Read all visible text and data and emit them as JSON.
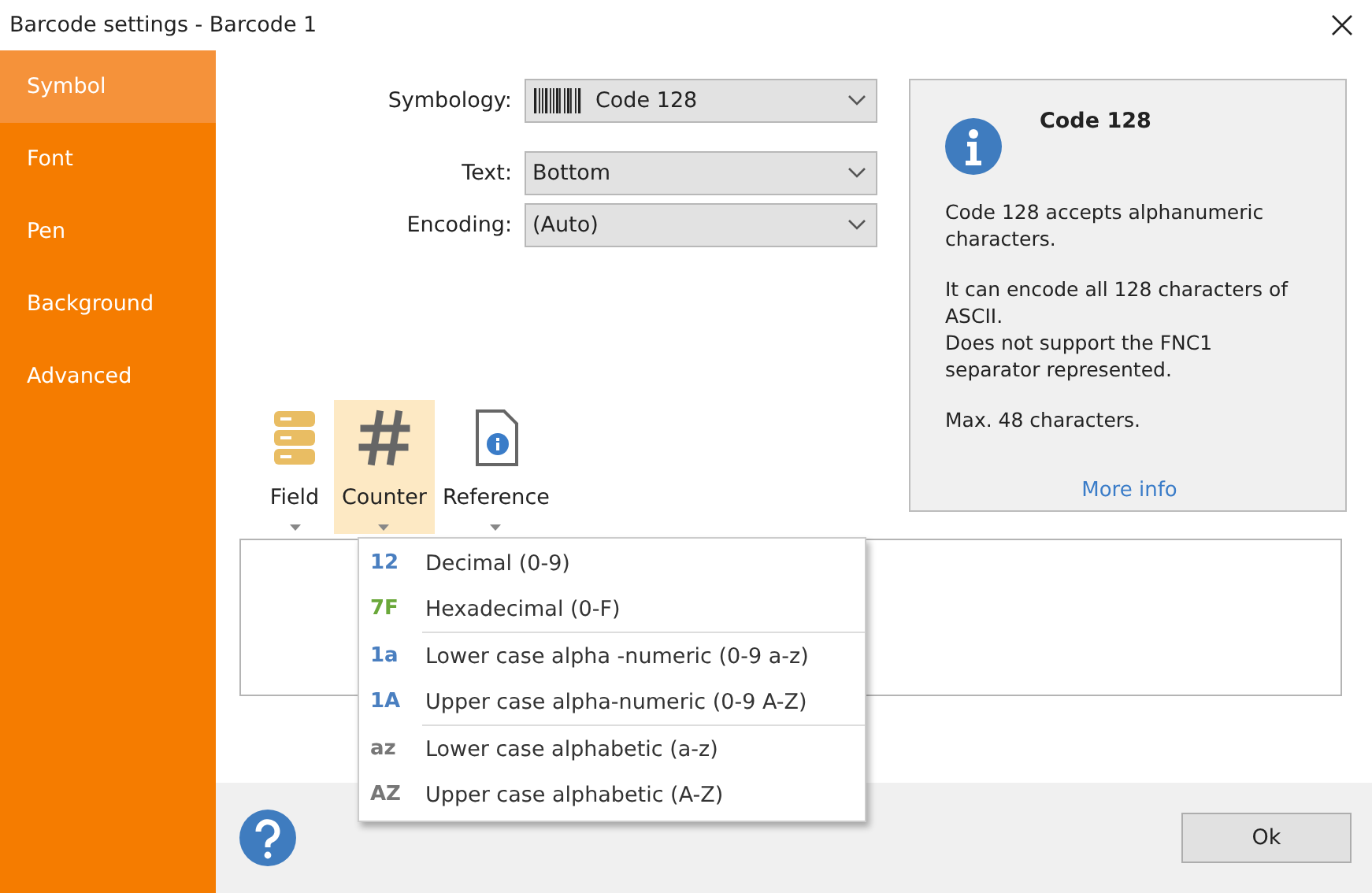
{
  "window": {
    "title": "Barcode settings - Barcode 1"
  },
  "sidebar": {
    "items": [
      {
        "label": "Symbol",
        "selected": true
      },
      {
        "label": "Font",
        "selected": false
      },
      {
        "label": "Pen",
        "selected": false
      },
      {
        "label": "Background",
        "selected": false
      },
      {
        "label": "Advanced",
        "selected": false
      }
    ]
  },
  "form": {
    "fields": [
      {
        "kind": "barcode",
        "label": "Symbology:",
        "value": "Code 128"
      },
      {
        "kind": "plain",
        "label": "Text:",
        "value": "Bottom"
      },
      {
        "kind": "plain",
        "label": "Encoding:",
        "value": "(Auto)"
      }
    ]
  },
  "info": {
    "title": "Code 128",
    "paragraphs": [
      "Code 128 accepts alphanumeric characters.",
      "It can encode all 128 characters of ASCII.\nDoes not support the FNC1 separator represented.",
      "Max. 48 characters."
    ],
    "link": "More info"
  },
  "toolbar": {
    "buttons": [
      {
        "kind": "field",
        "label": "Field",
        "selected": false
      },
      {
        "kind": "counter",
        "label": "Counter",
        "selected": true
      },
      {
        "kind": "reference",
        "label": "Reference",
        "selected": false
      }
    ]
  },
  "menu": {
    "sections": [
      [
        {
          "badge": "12",
          "label": "Decimal (0-9)",
          "color": "#4a7fc0"
        },
        {
          "badge": "7F",
          "label": "Hexadecimal (0-F)",
          "color": "#6aa83a"
        }
      ],
      [
        {
          "badge": "1a",
          "label": "Lower case alpha -numeric (0-9 a-z)",
          "color": "#4a7fc0"
        },
        {
          "badge": "1A",
          "label": "Upper case alpha-numeric (0-9 A-Z)",
          "color": "#4a7fc0"
        }
      ],
      [
        {
          "badge": "az",
          "label": "Lower case alphabetic (a-z)",
          "color": "#777777"
        },
        {
          "badge": "AZ",
          "label": "Upper case alphabetic (A-Z)",
          "color": "#777777"
        }
      ]
    ]
  },
  "buttons": {
    "ok": "Ok"
  }
}
